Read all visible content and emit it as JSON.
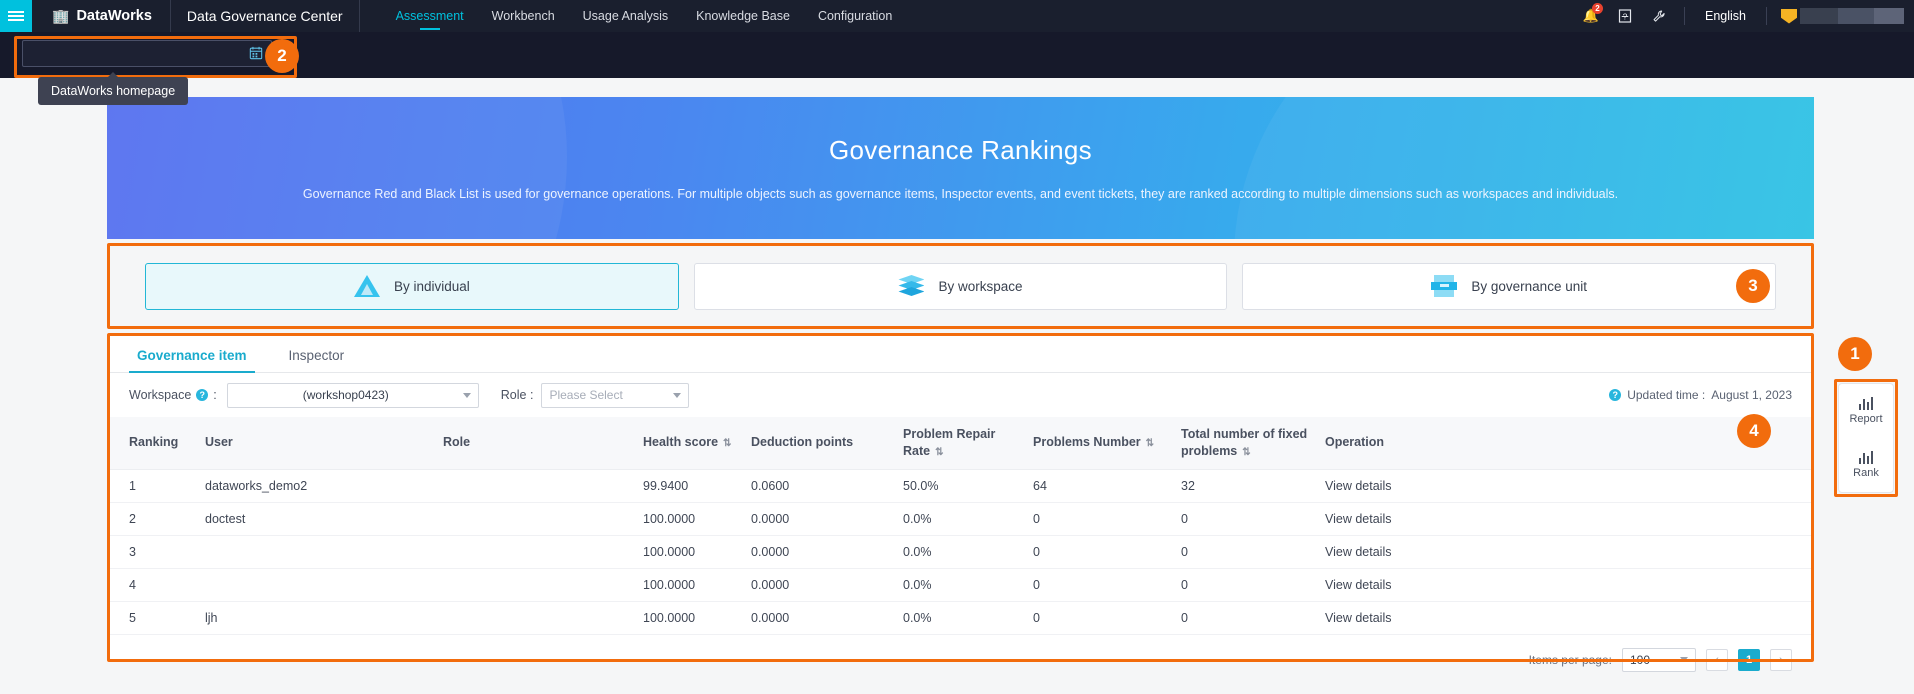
{
  "topnav": {
    "menu_icon": "hamburger-icon",
    "brand": "DataWorks",
    "product": "Data Governance Center",
    "links": [
      {
        "label": "Assessment",
        "active": true
      },
      {
        "label": "Workbench",
        "active": false
      },
      {
        "label": "Usage Analysis",
        "active": false
      },
      {
        "label": "Knowledge Base",
        "active": false
      },
      {
        "label": "Configuration",
        "active": false
      }
    ],
    "notifications_badge": "2",
    "bell_icon": "bell-icon",
    "help_icon": "help-icon",
    "tools_icon": "wrench-icon",
    "language": "English"
  },
  "subheader": {
    "tooltip": "DataWorks homepage",
    "date_value": "",
    "calendar_icon": "calendar-icon"
  },
  "banner": {
    "title": "Governance Rankings",
    "subtitle": "Governance Red and Black List is used for governance operations. For multiple objects such as governance items, Inspector events, and event tickets, they are ranked according to multiple dimensions such as workspaces and individuals."
  },
  "type_cards": [
    {
      "label": "By individual",
      "icon": "pyramid-icon",
      "active": true
    },
    {
      "label": "By workspace",
      "icon": "layers-icon",
      "active": false
    },
    {
      "label": "By governance unit",
      "icon": "unit-icon",
      "active": false
    }
  ],
  "panel": {
    "tabs": [
      {
        "label": "Governance item",
        "active": true
      },
      {
        "label": "Inspector",
        "active": false
      }
    ],
    "filters": {
      "workspace_label": "Workspace",
      "workspace_colon": ":",
      "workspace_value": "(workshop0423)",
      "role_label": "Role :",
      "role_placeholder": "Please Select",
      "updated_label": "Updated time :",
      "updated_value": "August 1, 2023",
      "info_icon": "info-icon"
    },
    "table": {
      "columns": [
        {
          "label": "Ranking",
          "sortable": false
        },
        {
          "label": "User",
          "sortable": false
        },
        {
          "label": "Role",
          "sortable": false
        },
        {
          "label": "Health score",
          "sortable": true
        },
        {
          "label": "Deduction points",
          "sortable": false
        },
        {
          "label": "Problem Repair Rate",
          "sortable": true
        },
        {
          "label": "Problems Number",
          "sortable": true
        },
        {
          "label": "Total number of fixed problems",
          "sortable": true
        },
        {
          "label": "Operation",
          "sortable": false
        }
      ],
      "rows": [
        {
          "ranking": "1",
          "user": "dataworks_demo2",
          "role": "",
          "health": "99.9400",
          "deduction": "0.0600",
          "repair_rate": "50.0%",
          "problems": "64",
          "fixed": "32",
          "operation": "View details"
        },
        {
          "ranking": "2",
          "user": "doctest",
          "role": "",
          "health": "100.0000",
          "deduction": "0.0000",
          "repair_rate": "0.0%",
          "problems": "0",
          "fixed": "0",
          "operation": "View details"
        },
        {
          "ranking": "3",
          "user": "",
          "role": "",
          "health": "100.0000",
          "deduction": "0.0000",
          "repair_rate": "0.0%",
          "problems": "0",
          "fixed": "0",
          "operation": "View details"
        },
        {
          "ranking": "4",
          "user": "",
          "role": "",
          "health": "100.0000",
          "deduction": "0.0000",
          "repair_rate": "0.0%",
          "problems": "0",
          "fixed": "0",
          "operation": "View details"
        },
        {
          "ranking": "5",
          "user": "ljh",
          "role": "",
          "health": "100.0000",
          "deduction": "0.0000",
          "repair_rate": "0.0%",
          "problems": "0",
          "fixed": "0",
          "operation": "View details"
        }
      ]
    },
    "pager": {
      "items_per_page_label": "Items per page:",
      "items_per_page_value": "100",
      "prev": "‹",
      "current_page": "1",
      "next": "›"
    }
  },
  "rail": [
    {
      "label": "Report",
      "icon": "bar-chart-icon"
    },
    {
      "label": "Rank",
      "icon": "bar-chart-icon"
    }
  ],
  "annotations": [
    {
      "num": "1"
    },
    {
      "num": "2"
    },
    {
      "num": "3"
    },
    {
      "num": "4"
    }
  ],
  "colors": {
    "accent_cyan": "#00c1de",
    "annotation_orange": "#f26c0d",
    "nav_dark": "#1a1f2e",
    "link_blue": "#2aa3d4"
  }
}
